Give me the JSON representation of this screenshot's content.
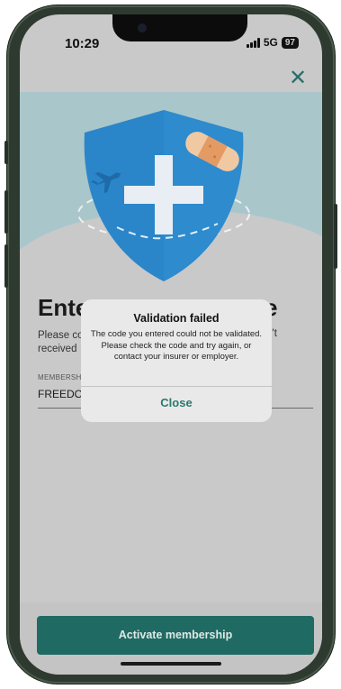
{
  "status_bar": {
    "time": "10:29",
    "network": "5G",
    "battery": "97"
  },
  "header": {
    "close_icon": "close-icon"
  },
  "hero": {
    "illustration": "shield-plus-plaster-airplane",
    "colors": {
      "shield": "#2a86c9",
      "background": "#a9c6cb"
    }
  },
  "page": {
    "headline_start": "Ente",
    "headline_end": "e",
    "paragraph_line1_start": "Please co",
    "paragraph_line1_end": "ven't",
    "paragraph_line2_start": "received",
    "field_label": "MEMBERSH",
    "field_value": "FREEDON"
  },
  "dialog": {
    "title": "Validation failed",
    "message": "The code you entered could not be validated. Please check the code and try again, or contact your insurer or employer.",
    "close_label": "Close"
  },
  "footer": {
    "activate_label": "Activate membership"
  },
  "colors": {
    "accent": "#1f6a62",
    "link": "#2a7a6f"
  }
}
